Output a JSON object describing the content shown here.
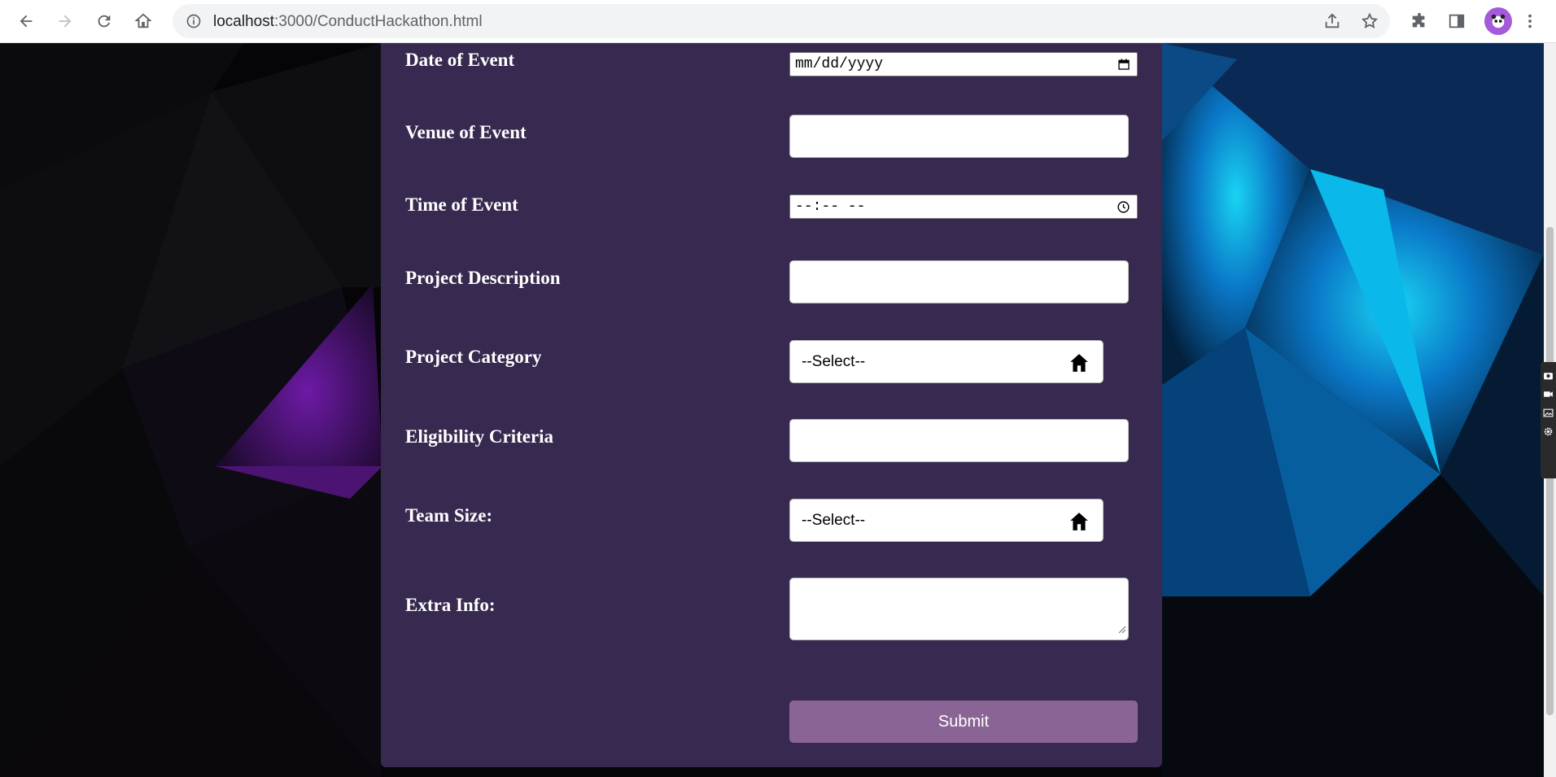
{
  "browser": {
    "url_host": "localhost",
    "url_path": ":3000/ConductHackathon.html"
  },
  "form": {
    "date_label": "Date of Event",
    "date_placeholder": "mm/dd/yyyy",
    "venue_label": "Venue of Event",
    "venue_value": "",
    "time_label": "Time of Event",
    "time_placeholder": "--:-- --",
    "description_label": "Project Description",
    "description_value": "",
    "category_label": "Project Category",
    "category_selected": "--Select--",
    "eligibility_label": "Eligibility Criteria",
    "eligibility_value": "",
    "team_size_label": "Team Size:",
    "team_size_selected": "--Select--",
    "extra_info_label": "Extra Info:",
    "extra_info_value": "",
    "submit_label": "Submit"
  },
  "colors": {
    "card": "#37294f",
    "submit": "#8b6496",
    "page_bg": "#050508"
  }
}
